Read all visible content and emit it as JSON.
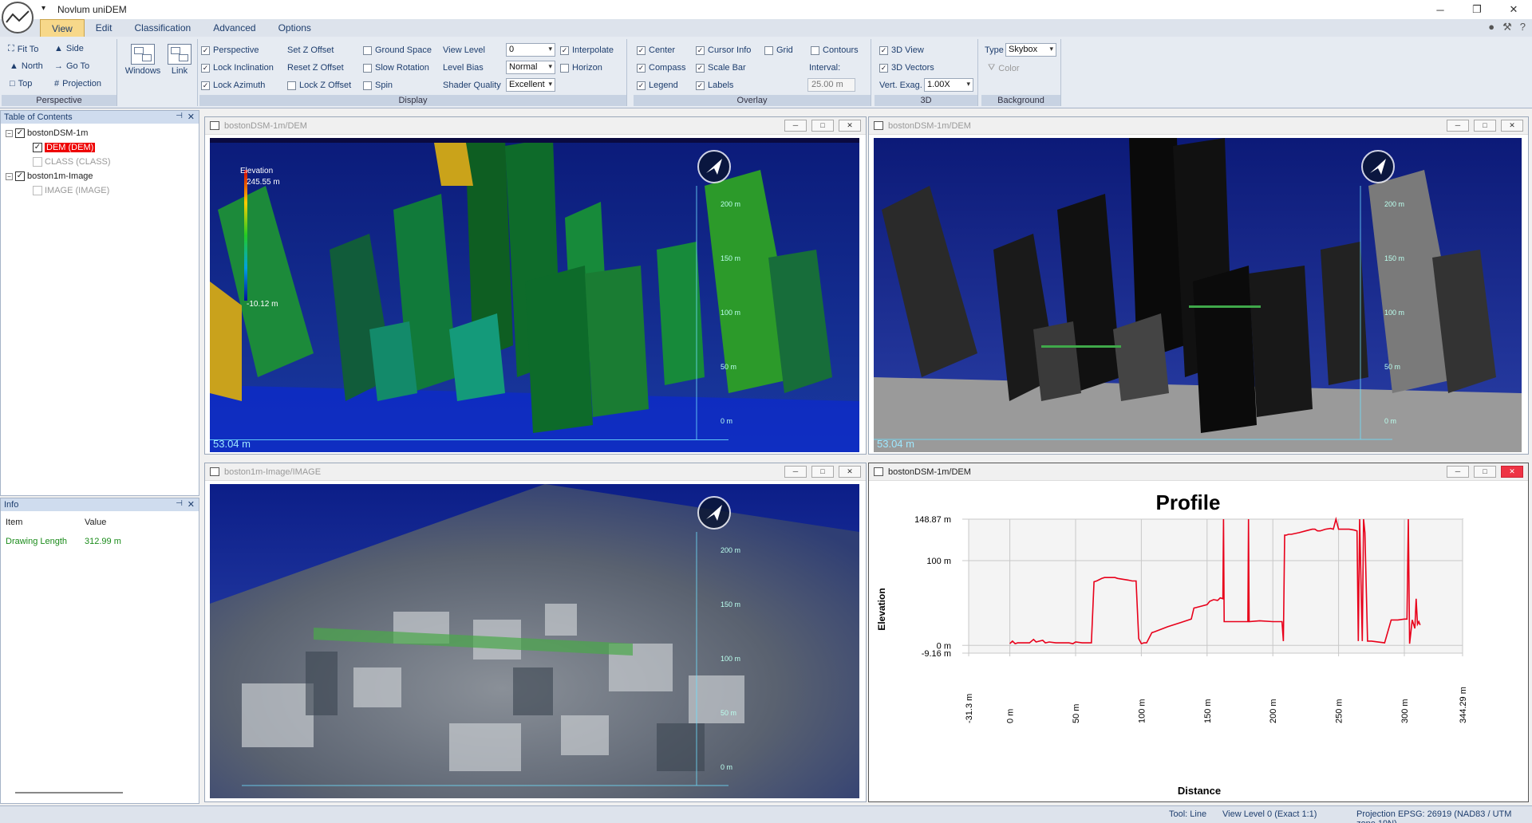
{
  "app": {
    "title": "Novlum uniDEM",
    "qat": "▾",
    "win_min": "─",
    "win_max": "❐",
    "win_close": "✕",
    "help": "?"
  },
  "tabs": [
    "View",
    "Edit",
    "Classification",
    "Advanced",
    "Options"
  ],
  "ribbon": {
    "perspective": {
      "label": "Perspective",
      "fit_to": "Fit To",
      "side": "Side",
      "north": "North",
      "go_to": "Go To",
      "top": "Top",
      "projection": "Projection"
    },
    "windows": {
      "windows": "Windows",
      "link": "Link"
    },
    "display": {
      "label": "Display",
      "perspective": "Perspective",
      "set_z_offset": "Set Z Offset",
      "ground_space": "Ground Space",
      "view_level_label": "View Level",
      "view_level": "0",
      "interpolate": "Interpolate",
      "lock_inclination": "Lock Inclination",
      "reset_z_offset": "Reset Z Offset",
      "slow_rotation": "Slow Rotation",
      "level_bias_label": "Level Bias",
      "level_bias": "Normal",
      "horizon": "Horizon",
      "lock_azimuth": "Lock Azimuth",
      "lock_z_offset": "Lock Z Offset",
      "spin": "Spin",
      "shader_quality_label": "Shader Quality",
      "shader_quality": "Excellent"
    },
    "overlay": {
      "label": "Overlay",
      "center": "Center",
      "cursor_info": "Cursor Info",
      "grid": "Grid",
      "contours": "Contours",
      "compass": "Compass",
      "scale_bar": "Scale Bar",
      "interval_label": "Interval:",
      "interval": "25.00 m",
      "legend": "Legend",
      "labels": "Labels"
    },
    "three_d": {
      "label": "3D",
      "view": "3D View",
      "vectors": "3D Vectors",
      "vert_exag_label": "Vert. Exag.",
      "vert_exag": "1.00X"
    },
    "background": {
      "label": "Background",
      "type_label": "Type",
      "type": "Skybox",
      "color": "Color"
    }
  },
  "toc": {
    "title": "Table of Contents",
    "layers": [
      {
        "name": "bostonDSM-1m",
        "children": [
          "DEM (DEM)",
          "CLASS (CLASS)"
        ]
      },
      {
        "name": "boston1m-Image",
        "children": [
          "IMAGE (IMAGE)"
        ]
      }
    ]
  },
  "info": {
    "title": "Info",
    "col_item": "Item",
    "col_value": "Value",
    "row_item": "Drawing Length",
    "row_value": "312.99 m"
  },
  "windows": {
    "dem_color": {
      "title": "bostonDSM-1m/DEM",
      "legend_title": "Elevation",
      "legend_max": "245.55 m",
      "legend_min": "-10.12 m",
      "scale": "53.04 m",
      "ticks": [
        "200 m",
        "150 m",
        "100 m",
        "50 m",
        "0 m"
      ]
    },
    "dem_gray": {
      "title": "bostonDSM-1m/DEM",
      "scale": "53.04 m",
      "ticks": [
        "200 m",
        "150 m",
        "100 m",
        "50 m",
        "0 m"
      ]
    },
    "image": {
      "title": "boston1m-Image/IMAGE",
      "ticks": [
        "200 m",
        "150 m",
        "100 m",
        "50 m",
        "0 m"
      ]
    },
    "profile": {
      "title": "bostonDSM-1m/DEM"
    }
  },
  "chart_data": {
    "type": "line",
    "title": "Profile",
    "xlabel": "Distance",
    "ylabel": "Elevation",
    "xlim": [
      -31.3,
      344.29
    ],
    "ylim": [
      -9.16,
      148.87
    ],
    "x_tick_labels": [
      "-31.3 m",
      "0 m",
      "50 m",
      "100 m",
      "150 m",
      "200 m",
      "250 m",
      "300 m",
      "344.29 m"
    ],
    "y_tick_labels": [
      "148.87 m",
      "100 m",
      "0 m",
      "-9.16 m"
    ],
    "series_color": "#e8001a",
    "series": [
      {
        "x": [
          0,
          2,
          4,
          6,
          15,
          18,
          20,
          25,
          27,
          30,
          35,
          45,
          48,
          50,
          55,
          60,
          62,
          64,
          66,
          70,
          72,
          80,
          82,
          90,
          93,
          96,
          98,
          100,
          102,
          104,
          108,
          110,
          120,
          130,
          138,
          140,
          145,
          150,
          152,
          155,
          158,
          160,
          162,
          162.5,
          163,
          164,
          170,
          175,
          180,
          181,
          181.5,
          182,
          190,
          200,
          207,
          208,
          209,
          210,
          212,
          214,
          220,
          225,
          230,
          232,
          234,
          236,
          240,
          244,
          246,
          248,
          250,
          252,
          258,
          262,
          264,
          265,
          266,
          268,
          269,
          270,
          272,
          275,
          285,
          290,
          295,
          300,
          302,
          303,
          304,
          306,
          308,
          309,
          310,
          311,
          312
        ],
        "y": [
          2,
          5,
          2,
          3,
          3,
          7,
          4,
          6,
          3,
          4,
          3,
          3,
          2,
          4,
          3,
          3,
          3,
          75,
          76,
          79,
          80,
          80,
          79,
          77,
          76,
          76,
          8,
          2,
          3,
          3,
          15,
          16,
          22,
          27,
          31,
          44,
          46,
          48,
          52,
          54,
          53,
          56,
          55,
          148.87,
          28,
          28,
          28,
          28,
          28,
          28,
          148.87,
          28,
          29,
          28,
          28,
          5,
          130,
          130,
          131,
          131,
          133,
          135,
          137,
          137,
          135,
          135,
          137,
          138,
          137,
          148.87,
          137,
          137,
          137,
          136,
          135,
          5,
          148.87,
          5,
          148.87,
          133,
          5,
          5,
          3,
          30,
          30,
          31,
          31,
          148.87,
          2,
          30,
          20,
          55,
          25,
          28,
          24
        ]
      }
    ]
  }
}
